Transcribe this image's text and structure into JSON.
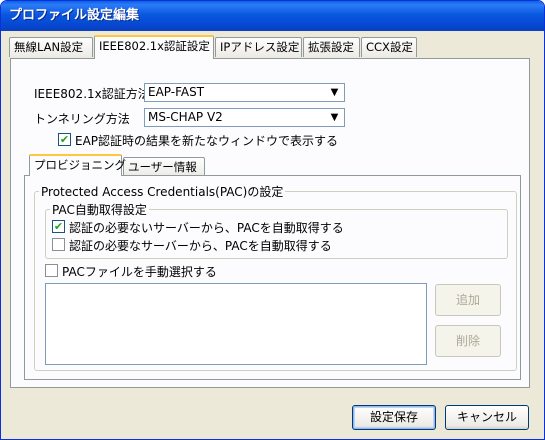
{
  "window": {
    "title": "プロファイル設定編集"
  },
  "tabs": [
    {
      "label": "無線LAN設定"
    },
    {
      "label": "IEEE802.1x認証設定"
    },
    {
      "label": "IPアドレス設定"
    },
    {
      "label": "拡張設定"
    },
    {
      "label": "CCX設定"
    }
  ],
  "auth": {
    "method_label": "IEEE802.1x認証方法",
    "method_value": "EAP-FAST",
    "tunnel_label": "トンネリング方法",
    "tunnel_value": "MS-CHAP V2",
    "show_result_label": "EAP認証時の結果を新たなウィンドウで表示する",
    "show_result_checked": true
  },
  "inner_tabs": [
    {
      "label": "プロビジョニング"
    },
    {
      "label": "ユーザー情報"
    }
  ],
  "pac": {
    "group_title": "Protected Access Credentials(PAC)の設定",
    "auto_group_title": "PAC自動取得設定",
    "auto_unauth_label": "認証の必要ないサーバーから、PACを自動取得する",
    "auto_unauth_checked": true,
    "auto_auth_label": "認証の必要なサーバーから、PACを自動取得する",
    "auto_auth_checked": false,
    "manual_label": "PACファイルを手動選択する",
    "manual_checked": false,
    "add_label": "追加",
    "delete_label": "削除"
  },
  "footer": {
    "save_label": "設定保存",
    "cancel_label": "キャンセル"
  },
  "colors": {
    "titlebar": "#0a58e0",
    "face": "#ece9d8",
    "check": "#21a121"
  }
}
